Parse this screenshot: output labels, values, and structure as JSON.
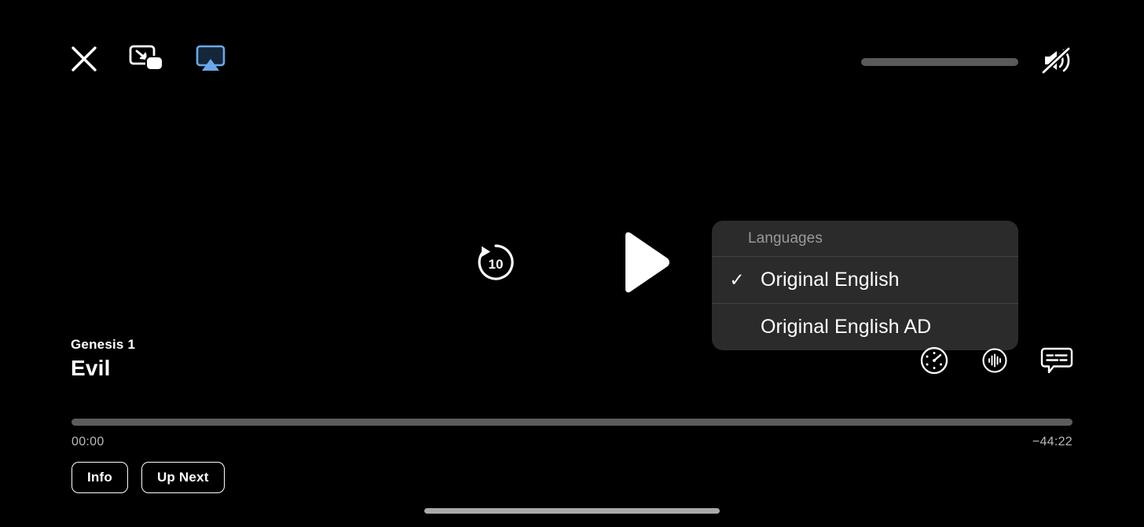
{
  "app": {
    "background_color": "#000000",
    "accent_color": "#6aa9e9"
  },
  "top_bar": {
    "close_icon": "close-x-icon",
    "pip_icon": "picture-in-picture-icon",
    "airplay_icon": "airplay-icon",
    "airplay_color": "#6aa9e9",
    "volume": {
      "icon": "speaker-muted-icon",
      "level_percent": 0,
      "muted": true,
      "track_color": "#5a5a5a"
    }
  },
  "center_controls": {
    "skip_back_icon": "skip-back-10-icon",
    "skip_back_seconds": "10",
    "play_icon": "play-icon",
    "play_state": "paused"
  },
  "languages_menu": {
    "header": "Languages",
    "background_color": "#2b2b2b",
    "items": [
      {
        "label": "Original English",
        "selected": true,
        "check": "✓"
      },
      {
        "label": "Original English AD",
        "selected": false,
        "check": ""
      }
    ]
  },
  "now_playing": {
    "series": "Genesis 1",
    "title": "Evil"
  },
  "option_icons": [
    {
      "name": "playback-speed-icon",
      "label": "Playback Speed"
    },
    {
      "name": "audio-track-icon",
      "label": "Audio"
    },
    {
      "name": "subtitles-icon",
      "label": "Subtitles"
    }
  ],
  "scrubber": {
    "progress_percent": 0,
    "elapsed": "00:00",
    "remaining": "−44:22",
    "track_color": "#5c5c5c"
  },
  "bottom_buttons": [
    {
      "label": "Info",
      "name": "info-button"
    },
    {
      "label": "Up Next",
      "name": "up-next-button"
    }
  ],
  "home_indicator": {
    "color": "#a9a9a9"
  }
}
